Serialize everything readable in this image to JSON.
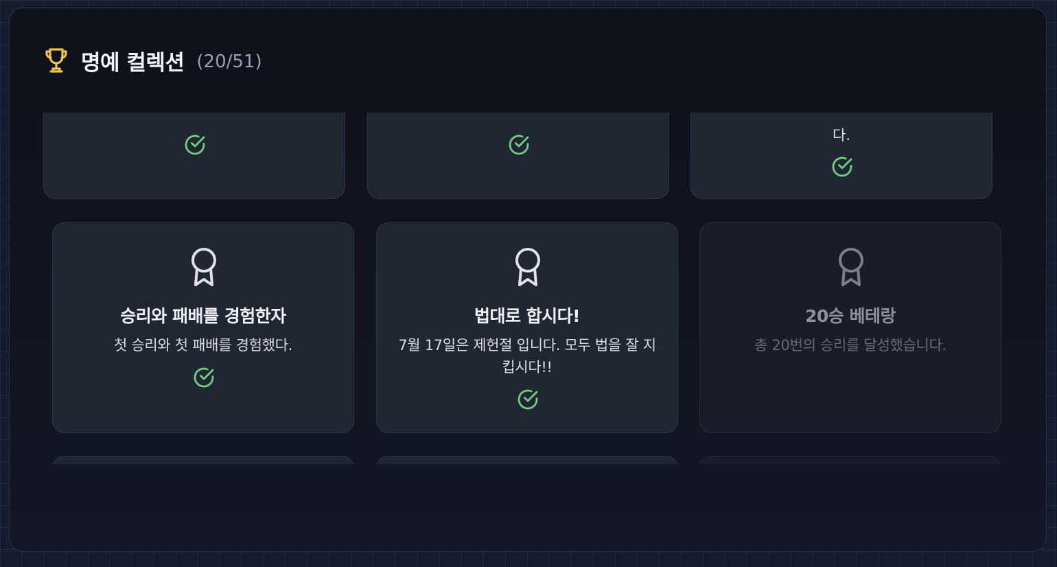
{
  "panel": {
    "title": "명예 컬렉션",
    "count": "(20/51)",
    "icon": "trophy-icon",
    "accent_color": "#f2c14e"
  },
  "top_row": [
    {
      "unlocked": true,
      "desc_tail": ""
    },
    {
      "unlocked": true,
      "desc_tail": ""
    },
    {
      "unlocked": true,
      "desc_tail": "다."
    }
  ],
  "achievements": [
    {
      "title": "승리와 패배를 경험한자",
      "description": "첫 승리와 첫 패배를 경험했다.",
      "unlocked": true,
      "icon": "award-icon"
    },
    {
      "title": "법대로 합시다!",
      "description": "7월 17일은 제헌절 입니다. 모두 법을 잘 지킵시다!!",
      "unlocked": true,
      "icon": "award-icon"
    },
    {
      "title": "20승 베테랑",
      "description": "총 20번의 승리를 달성했습니다.",
      "unlocked": false,
      "icon": "award-icon"
    }
  ],
  "colors": {
    "check": "#6fcf7f",
    "badge_unlocked": "#dfe1e7",
    "badge_locked": "#7a7f8c"
  }
}
